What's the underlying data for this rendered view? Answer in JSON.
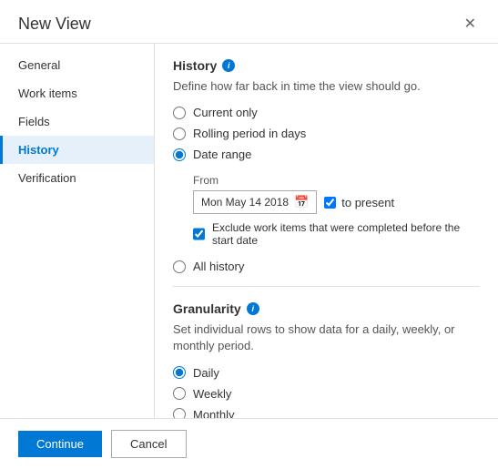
{
  "dialog": {
    "title": "New View",
    "close_label": "✕"
  },
  "sidebar": {
    "items": [
      {
        "id": "general",
        "label": "General",
        "active": false
      },
      {
        "id": "work-items",
        "label": "Work items",
        "active": false
      },
      {
        "id": "fields",
        "label": "Fields",
        "active": false
      },
      {
        "id": "history",
        "label": "History",
        "active": true
      },
      {
        "id": "verification",
        "label": "Verification",
        "active": false
      }
    ]
  },
  "content": {
    "history_section": {
      "title": "History",
      "info_icon": "i",
      "description": "Define how far back in time the view should go.",
      "radio_options": [
        {
          "id": "current-only",
          "label": "Current only",
          "checked": false
        },
        {
          "id": "rolling-period",
          "label": "Rolling period in days",
          "checked": false
        },
        {
          "id": "date-range",
          "label": "Date range",
          "checked": true
        },
        {
          "id": "all-history",
          "label": "All history",
          "checked": false
        }
      ],
      "date_range": {
        "from_label": "From",
        "date_value": "Mon May 14 2018",
        "calendar_icon": "📅",
        "to_present_label": "to present",
        "exclude_label": "Exclude work items that were completed before the start date",
        "exclude_checked": true
      }
    },
    "granularity_section": {
      "title": "Granularity",
      "info_icon": "i",
      "description": "Set individual rows to show data for a daily, weekly, or monthly period.",
      "radio_options": [
        {
          "id": "daily",
          "label": "Daily",
          "checked": true
        },
        {
          "id": "weekly",
          "label": "Weekly",
          "checked": false
        },
        {
          "id": "monthly",
          "label": "Monthly",
          "checked": false
        }
      ]
    }
  },
  "footer": {
    "continue_label": "Continue",
    "cancel_label": "Cancel"
  }
}
